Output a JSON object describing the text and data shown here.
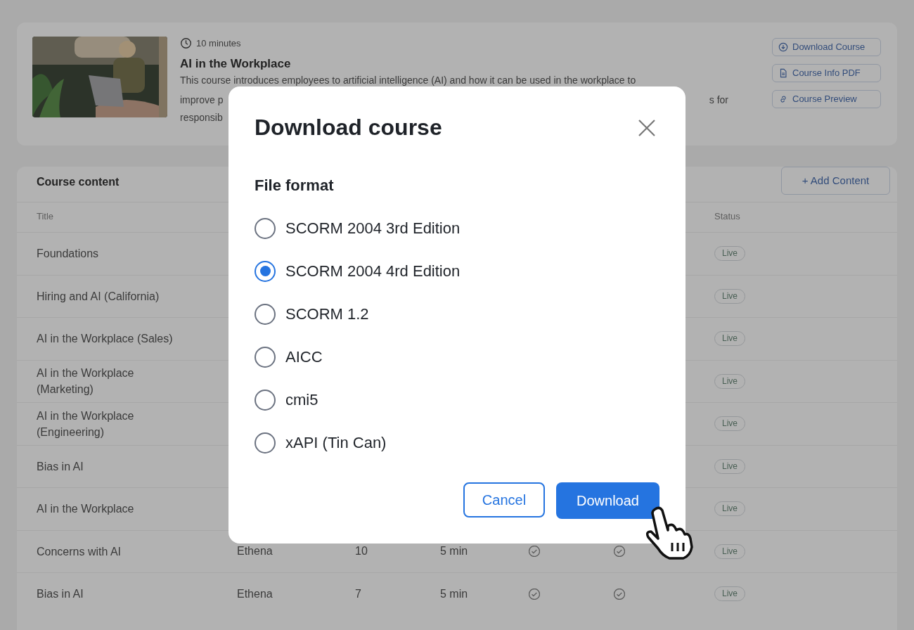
{
  "course": {
    "duration": "10 minutes",
    "title": "AI in the Workplace",
    "description_lines": [
      {
        "left": "This course introduces employees to artificial intelligence (AI) and how it can be used in the workplace to"
      },
      {
        "left": "improve p",
        "right": "s for"
      },
      {
        "left": "responsib"
      }
    ],
    "actions": [
      {
        "kind": "download",
        "label": "Download Course"
      },
      {
        "kind": "pdf",
        "label": "Course Info PDF"
      },
      {
        "kind": "link",
        "label": "Course Preview"
      }
    ]
  },
  "content": {
    "title": "Course content",
    "add_button": "+ Add Content",
    "columns": {
      "title": "Title",
      "status": "Status"
    },
    "rows": [
      {
        "title": "Foundations",
        "status": "Live"
      },
      {
        "title": "Hiring and AI (California)",
        "status": "Live"
      },
      {
        "title": "AI in the Workplace (Sales)",
        "status": "Live"
      },
      {
        "title": "AI in the Workplace (Marketing)",
        "status": "Live"
      },
      {
        "title": "AI in the Workplace (Engineering)",
        "status": "Live"
      },
      {
        "title": "Bias in AI",
        "status": "Live"
      },
      {
        "title": "AI in the Workplace",
        "status": "Live"
      },
      {
        "title": "Concerns with AI",
        "author": "Ethena",
        "count": "10",
        "duration": "5 min",
        "check_1": true,
        "check_2": true,
        "status": "Live"
      },
      {
        "title": "Bias in AI",
        "author": "Ethena",
        "count": "7",
        "duration": "5 min",
        "check_1": true,
        "check_2": true,
        "status": "Live"
      }
    ]
  },
  "dialog": {
    "title": "Download course",
    "section": "File format",
    "options": [
      {
        "label": "SCORM 2004 3rd Edition",
        "selected": false
      },
      {
        "label": "SCORM 2004 4rd Edition",
        "selected": true
      },
      {
        "label": "SCORM 1.2",
        "selected": false
      },
      {
        "label": "AICC",
        "selected": false
      },
      {
        "label": "cmi5",
        "selected": false
      },
      {
        "label": "xAPI (Tin Can)",
        "selected": false
      }
    ],
    "cancel": "Cancel",
    "confirm": "Download"
  }
}
